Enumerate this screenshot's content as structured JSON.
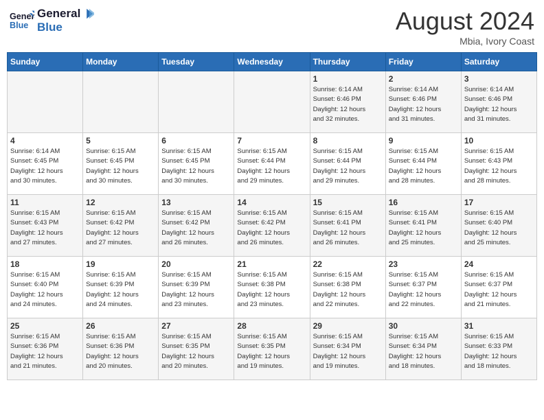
{
  "header": {
    "logo_line1": "General",
    "logo_line2": "Blue",
    "month_year": "August 2024",
    "location": "Mbia, Ivory Coast"
  },
  "days_of_week": [
    "Sunday",
    "Monday",
    "Tuesday",
    "Wednesday",
    "Thursday",
    "Friday",
    "Saturday"
  ],
  "weeks": [
    [
      {
        "day": "",
        "info": ""
      },
      {
        "day": "",
        "info": ""
      },
      {
        "day": "",
        "info": ""
      },
      {
        "day": "",
        "info": ""
      },
      {
        "day": "1",
        "info": "Sunrise: 6:14 AM\nSunset: 6:46 PM\nDaylight: 12 hours\nand 32 minutes."
      },
      {
        "day": "2",
        "info": "Sunrise: 6:14 AM\nSunset: 6:46 PM\nDaylight: 12 hours\nand 31 minutes."
      },
      {
        "day": "3",
        "info": "Sunrise: 6:14 AM\nSunset: 6:46 PM\nDaylight: 12 hours\nand 31 minutes."
      }
    ],
    [
      {
        "day": "4",
        "info": "Sunrise: 6:14 AM\nSunset: 6:45 PM\nDaylight: 12 hours\nand 30 minutes."
      },
      {
        "day": "5",
        "info": "Sunrise: 6:15 AM\nSunset: 6:45 PM\nDaylight: 12 hours\nand 30 minutes."
      },
      {
        "day": "6",
        "info": "Sunrise: 6:15 AM\nSunset: 6:45 PM\nDaylight: 12 hours\nand 30 minutes."
      },
      {
        "day": "7",
        "info": "Sunrise: 6:15 AM\nSunset: 6:44 PM\nDaylight: 12 hours\nand 29 minutes."
      },
      {
        "day": "8",
        "info": "Sunrise: 6:15 AM\nSunset: 6:44 PM\nDaylight: 12 hours\nand 29 minutes."
      },
      {
        "day": "9",
        "info": "Sunrise: 6:15 AM\nSunset: 6:44 PM\nDaylight: 12 hours\nand 28 minutes."
      },
      {
        "day": "10",
        "info": "Sunrise: 6:15 AM\nSunset: 6:43 PM\nDaylight: 12 hours\nand 28 minutes."
      }
    ],
    [
      {
        "day": "11",
        "info": "Sunrise: 6:15 AM\nSunset: 6:43 PM\nDaylight: 12 hours\nand 27 minutes."
      },
      {
        "day": "12",
        "info": "Sunrise: 6:15 AM\nSunset: 6:42 PM\nDaylight: 12 hours\nand 27 minutes."
      },
      {
        "day": "13",
        "info": "Sunrise: 6:15 AM\nSunset: 6:42 PM\nDaylight: 12 hours\nand 26 minutes."
      },
      {
        "day": "14",
        "info": "Sunrise: 6:15 AM\nSunset: 6:42 PM\nDaylight: 12 hours\nand 26 minutes."
      },
      {
        "day": "15",
        "info": "Sunrise: 6:15 AM\nSunset: 6:41 PM\nDaylight: 12 hours\nand 26 minutes."
      },
      {
        "day": "16",
        "info": "Sunrise: 6:15 AM\nSunset: 6:41 PM\nDaylight: 12 hours\nand 25 minutes."
      },
      {
        "day": "17",
        "info": "Sunrise: 6:15 AM\nSunset: 6:40 PM\nDaylight: 12 hours\nand 25 minutes."
      }
    ],
    [
      {
        "day": "18",
        "info": "Sunrise: 6:15 AM\nSunset: 6:40 PM\nDaylight: 12 hours\nand 24 minutes."
      },
      {
        "day": "19",
        "info": "Sunrise: 6:15 AM\nSunset: 6:39 PM\nDaylight: 12 hours\nand 24 minutes."
      },
      {
        "day": "20",
        "info": "Sunrise: 6:15 AM\nSunset: 6:39 PM\nDaylight: 12 hours\nand 23 minutes."
      },
      {
        "day": "21",
        "info": "Sunrise: 6:15 AM\nSunset: 6:38 PM\nDaylight: 12 hours\nand 23 minutes."
      },
      {
        "day": "22",
        "info": "Sunrise: 6:15 AM\nSunset: 6:38 PM\nDaylight: 12 hours\nand 22 minutes."
      },
      {
        "day": "23",
        "info": "Sunrise: 6:15 AM\nSunset: 6:37 PM\nDaylight: 12 hours\nand 22 minutes."
      },
      {
        "day": "24",
        "info": "Sunrise: 6:15 AM\nSunset: 6:37 PM\nDaylight: 12 hours\nand 21 minutes."
      }
    ],
    [
      {
        "day": "25",
        "info": "Sunrise: 6:15 AM\nSunset: 6:36 PM\nDaylight: 12 hours\nand 21 minutes."
      },
      {
        "day": "26",
        "info": "Sunrise: 6:15 AM\nSunset: 6:36 PM\nDaylight: 12 hours\nand 20 minutes."
      },
      {
        "day": "27",
        "info": "Sunrise: 6:15 AM\nSunset: 6:35 PM\nDaylight: 12 hours\nand 20 minutes."
      },
      {
        "day": "28",
        "info": "Sunrise: 6:15 AM\nSunset: 6:35 PM\nDaylight: 12 hours\nand 19 minutes."
      },
      {
        "day": "29",
        "info": "Sunrise: 6:15 AM\nSunset: 6:34 PM\nDaylight: 12 hours\nand 19 minutes."
      },
      {
        "day": "30",
        "info": "Sunrise: 6:15 AM\nSunset: 6:34 PM\nDaylight: 12 hours\nand 18 minutes."
      },
      {
        "day": "31",
        "info": "Sunrise: 6:15 AM\nSunset: 6:33 PM\nDaylight: 12 hours\nand 18 minutes."
      }
    ]
  ]
}
